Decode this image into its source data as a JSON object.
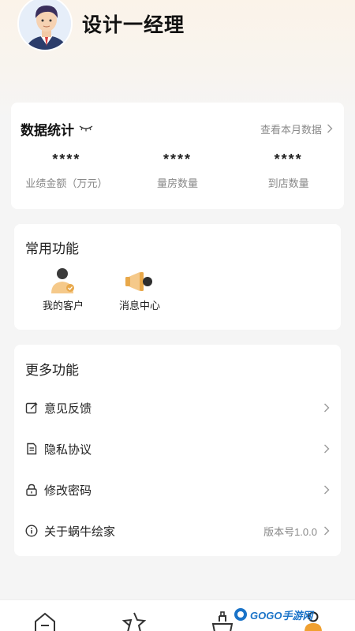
{
  "profile": {
    "name": "设计一经理",
    "avatar": "manager-avatar"
  },
  "stats": {
    "title": "数据统计",
    "link_label": "查看本月数据",
    "items": [
      {
        "value": "****",
        "label": "业绩金额（万元）"
      },
      {
        "value": "****",
        "label": "量房数量"
      },
      {
        "value": "****",
        "label": "到店数量"
      }
    ]
  },
  "common": {
    "title": "常用功能",
    "items": [
      {
        "label": "我的客户",
        "icon": "customer-icon"
      },
      {
        "label": "消息中心",
        "icon": "megaphone-icon"
      }
    ]
  },
  "more": {
    "title": "更多功能",
    "rows": [
      {
        "label": "意见反馈",
        "icon": "edit-icon",
        "extra": ""
      },
      {
        "label": "隐私协议",
        "icon": "document-icon",
        "extra": ""
      },
      {
        "label": "修改密码",
        "icon": "lock-icon",
        "extra": ""
      },
      {
        "label": "关于蜗牛绘家",
        "icon": "info-icon",
        "extra": "版本号1.0.0"
      }
    ]
  },
  "tabbar": {
    "tabs": [
      "home-icon",
      "star-icon",
      "ship-icon",
      "profile-icon"
    ]
  },
  "watermark": {
    "text": "GOGO手游网",
    "color": "#1a73c8"
  },
  "colors": {
    "accent": "#f0a030",
    "background": "#f5f5f5"
  }
}
